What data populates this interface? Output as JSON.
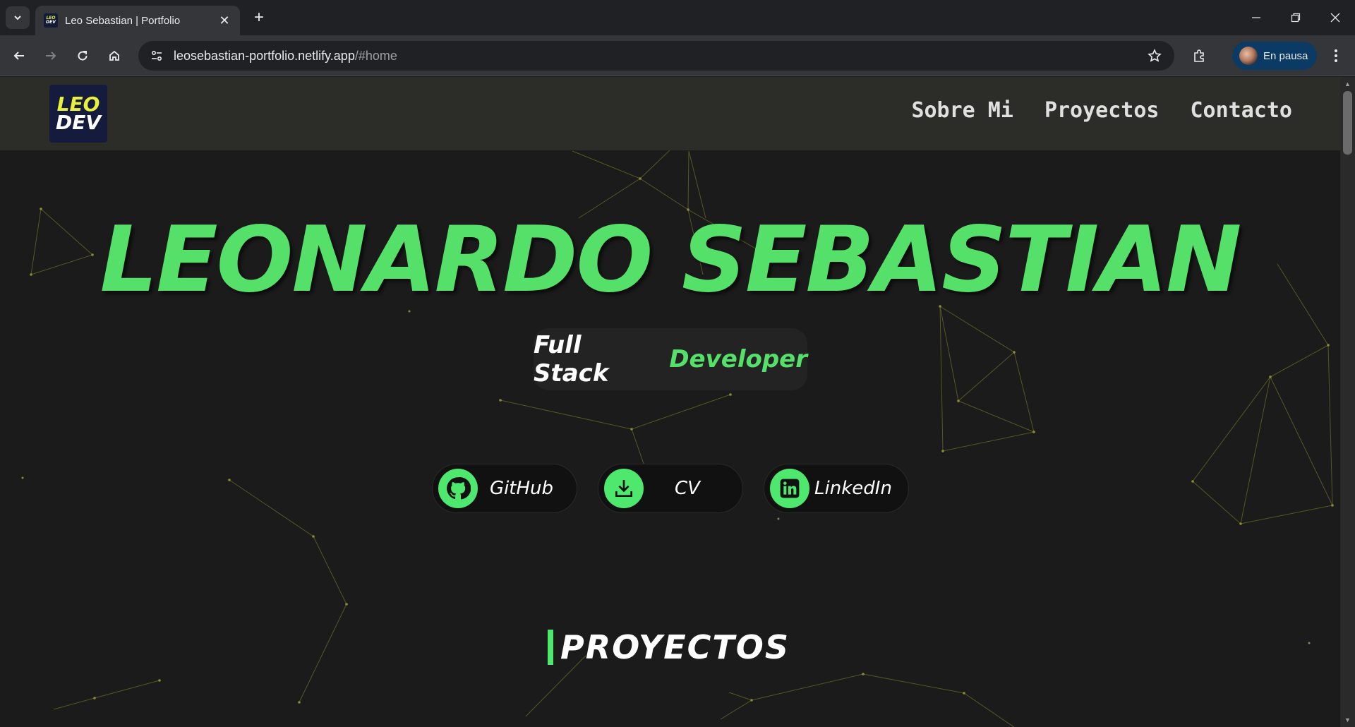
{
  "browser": {
    "tab_title": "Leo Sebastian | Portfolio",
    "url_host": "leosebastian-portfolio.netlify.app",
    "url_path": "/#home",
    "profile_label": "En pausa",
    "favicon_line1": "LEO",
    "favicon_line2": "DEV"
  },
  "site": {
    "logo_line1": "LEO",
    "logo_line2": "DEV",
    "nav": [
      "Sobre Mi",
      "Proyectos",
      "Contacto"
    ],
    "hero_name": "LEONARDO SEBASTIAN",
    "role_white": "Full Stack",
    "role_green": "Developer",
    "buttons": [
      {
        "label": "GitHub",
        "icon": "github-icon"
      },
      {
        "label": "CV",
        "icon": "download-icon"
      },
      {
        "label": "LinkedIn",
        "icon": "linkedin-icon"
      }
    ],
    "section_title": "PROYECTOS"
  },
  "colors": {
    "accent_green": "#55e06a",
    "logo_yellow": "#e8f03b",
    "page_bg": "#1b1b1b",
    "header_bg": "#2c2c28"
  }
}
